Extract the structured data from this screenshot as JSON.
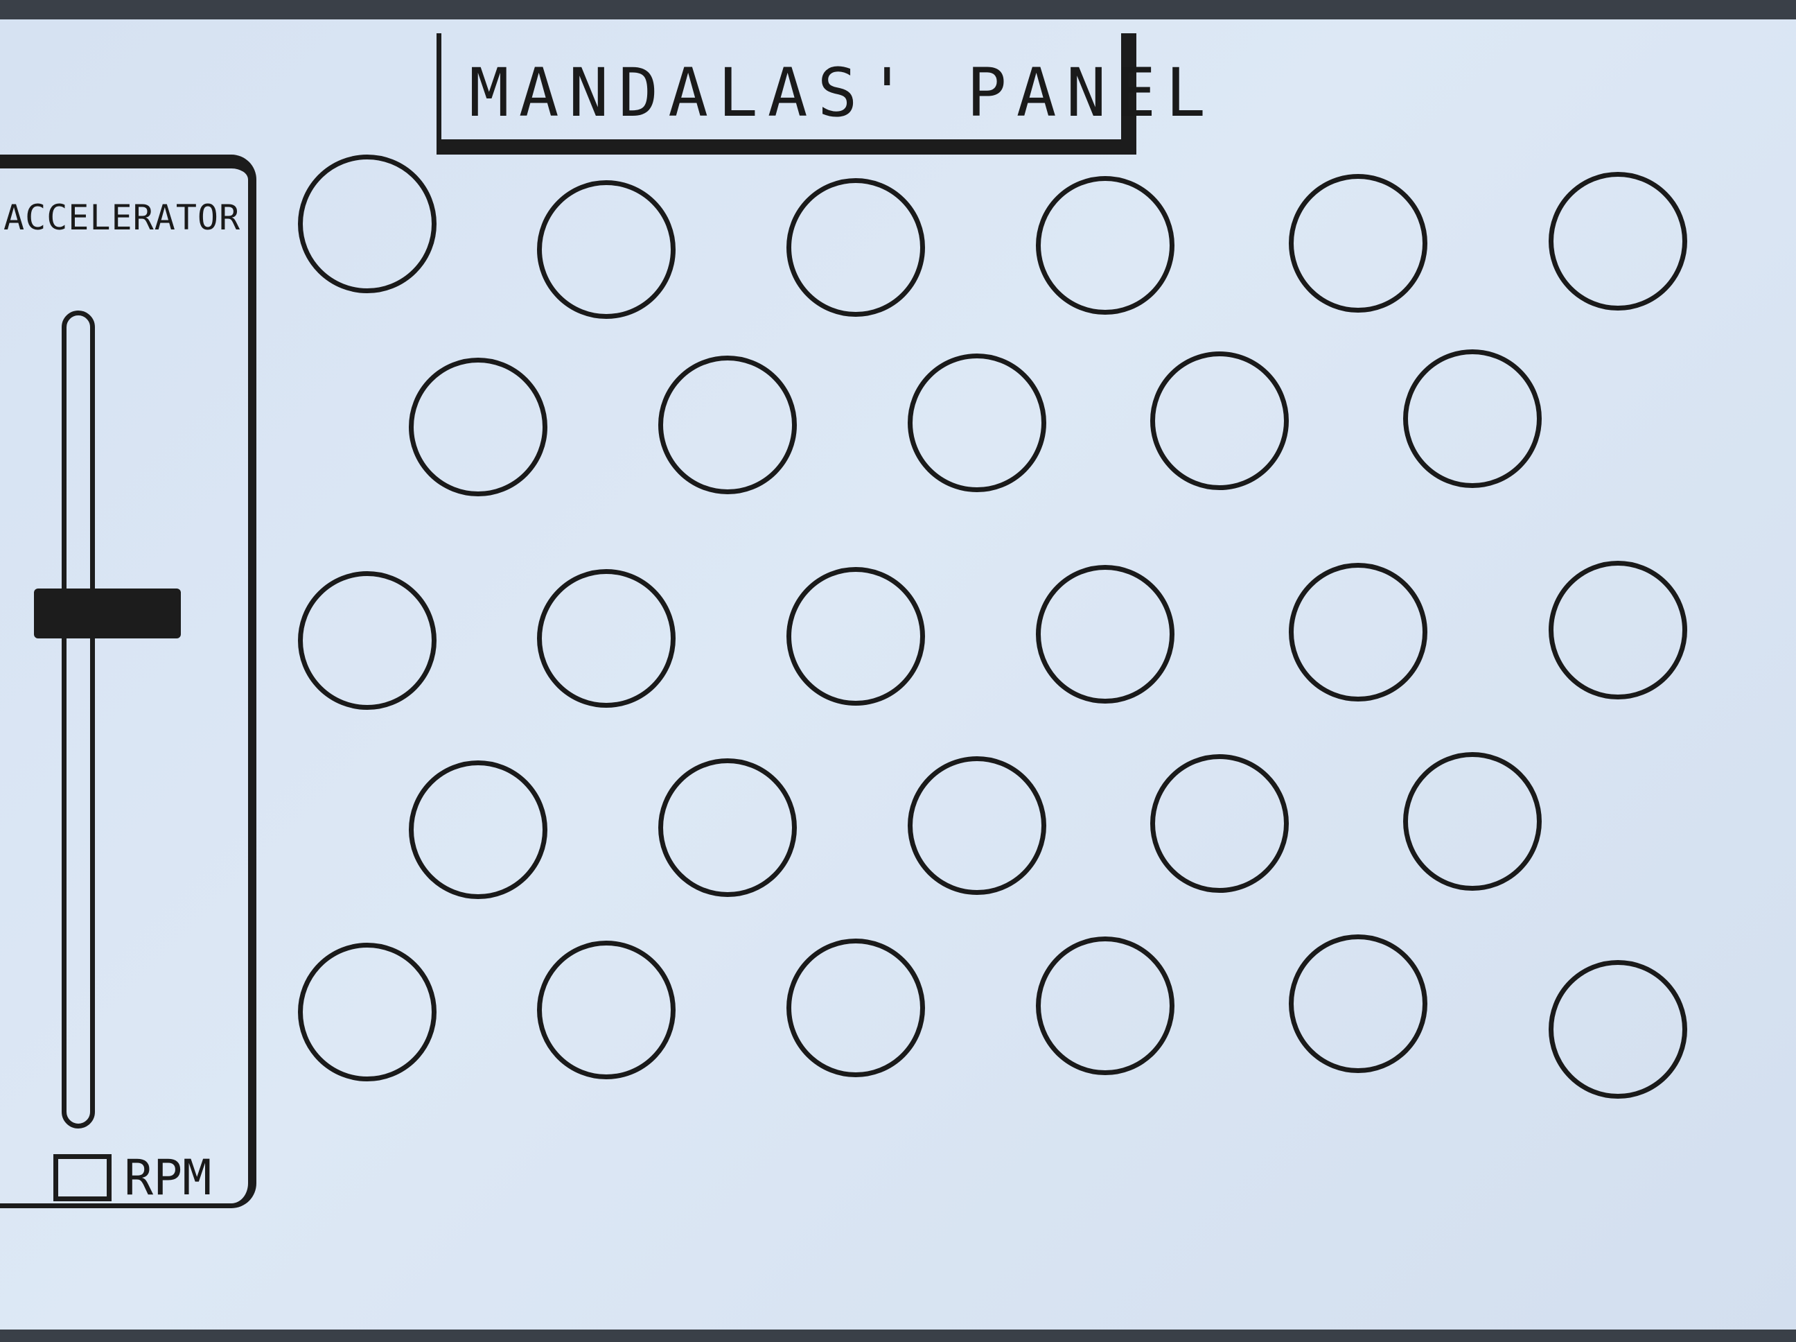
{
  "title": "MANDALAS' PANEL",
  "accelerator": {
    "title": "ACCELERATOR",
    "slider_level": 0.37,
    "rpm_label": "RPM"
  },
  "mandalas": {
    "rows": [
      6,
      5,
      6,
      5,
      6
    ]
  },
  "colors": {
    "ink": "#1c1c1c",
    "paper": "#d9e5f3"
  }
}
